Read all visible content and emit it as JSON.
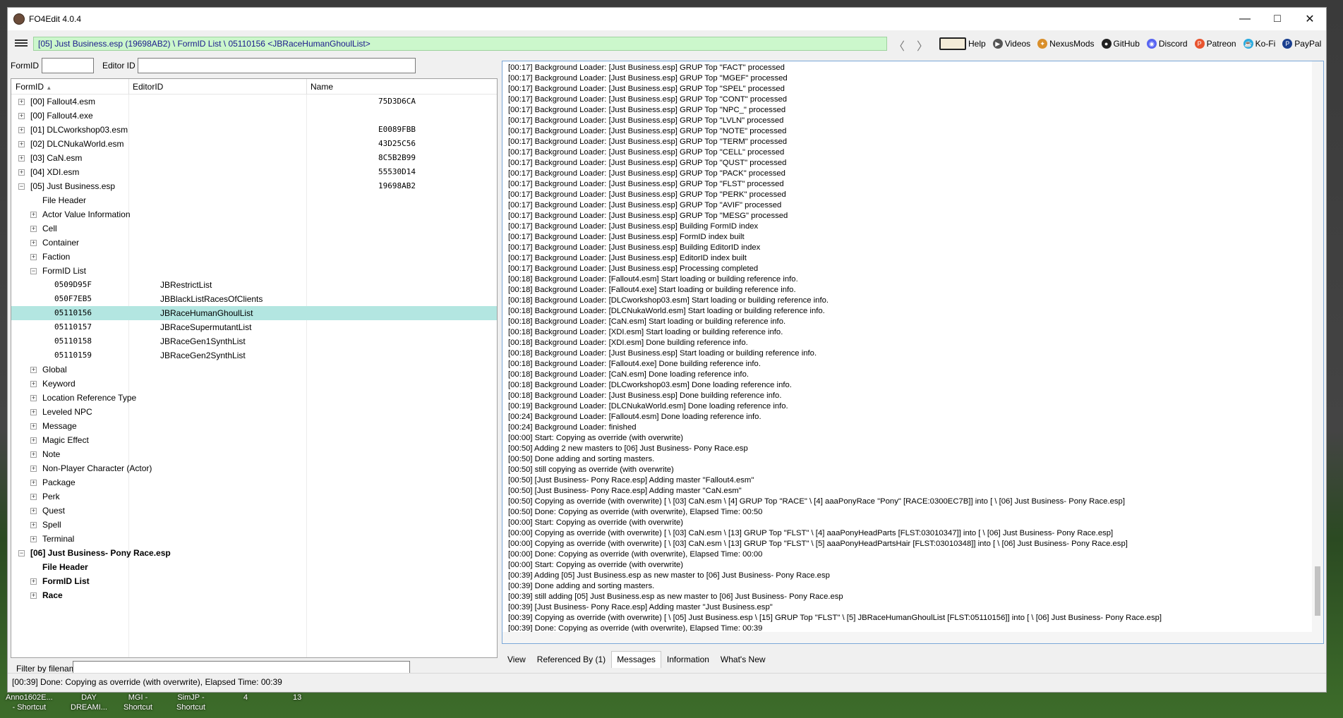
{
  "window": {
    "title": "FO4Edit 4.0.4"
  },
  "toolbar": {
    "path": "[05] Just Business.esp (19698AB2) \\ FormID List \\ 05110156 <JBRaceHumanGhoulList>",
    "back": "〈",
    "forward": "〉",
    "links": [
      "Help",
      "Videos",
      "NexusMods",
      "GitHub",
      "Discord",
      "Patreon",
      "Ko-Fi",
      "PayPal"
    ]
  },
  "search": {
    "formid_label": "FormID",
    "editorid_label": "Editor ID",
    "formid_value": "",
    "editorid_value": ""
  },
  "tree": {
    "headers": {
      "formid": "FormID",
      "editorid": "EditorID",
      "name": "Name"
    },
    "rows": [
      {
        "indent": 0,
        "pm": "+",
        "text": "[00] Fallout4.esm",
        "name": "75D3D6CA"
      },
      {
        "indent": 0,
        "pm": "+",
        "text": "[00] Fallout4.exe",
        "name": ""
      },
      {
        "indent": 0,
        "pm": "+",
        "text": "[01] DLCworkshop03.esm",
        "name": "E0089FBB"
      },
      {
        "indent": 0,
        "pm": "+",
        "text": "[02] DLCNukaWorld.esm",
        "name": "43D25C56"
      },
      {
        "indent": 0,
        "pm": "+",
        "text": "[03] CaN.esm",
        "name": "8C5B2B99"
      },
      {
        "indent": 0,
        "pm": "+",
        "text": "[04] XDI.esm",
        "name": "55530D14"
      },
      {
        "indent": 0,
        "pm": "-",
        "text": "[05] Just Business.esp",
        "name": "19698AB2"
      },
      {
        "indent": 1,
        "pm": "",
        "text": "File Header"
      },
      {
        "indent": 1,
        "pm": "+",
        "text": "Actor Value Information"
      },
      {
        "indent": 1,
        "pm": "+",
        "text": "Cell"
      },
      {
        "indent": 1,
        "pm": "+",
        "text": "Container"
      },
      {
        "indent": 1,
        "pm": "+",
        "text": "Faction"
      },
      {
        "indent": 1,
        "pm": "-",
        "text": "FormID List"
      },
      {
        "indent": 2,
        "pm": "",
        "text": "0509D95F",
        "edid": "JBRestrictList",
        "mono": true
      },
      {
        "indent": 2,
        "pm": "",
        "text": "050F7EB5",
        "edid": "JBBlackListRacesOfClients",
        "mono": true
      },
      {
        "indent": 2,
        "pm": "",
        "text": "05110156",
        "edid": "JBRaceHumanGhoulList",
        "mono": true,
        "selected": true
      },
      {
        "indent": 2,
        "pm": "",
        "text": "05110157",
        "edid": "JBRaceSupermutantList",
        "mono": true
      },
      {
        "indent": 2,
        "pm": "",
        "text": "05110158",
        "edid": "JBRaceGen1SynthList",
        "mono": true
      },
      {
        "indent": 2,
        "pm": "",
        "text": "05110159",
        "edid": "JBRaceGen2SynthList",
        "mono": true
      },
      {
        "indent": 1,
        "pm": "+",
        "text": "Global"
      },
      {
        "indent": 1,
        "pm": "+",
        "text": "Keyword"
      },
      {
        "indent": 1,
        "pm": "+",
        "text": "Location Reference Type"
      },
      {
        "indent": 1,
        "pm": "+",
        "text": "Leveled NPC"
      },
      {
        "indent": 1,
        "pm": "+",
        "text": "Message"
      },
      {
        "indent": 1,
        "pm": "+",
        "text": "Magic Effect"
      },
      {
        "indent": 1,
        "pm": "+",
        "text": "Note"
      },
      {
        "indent": 1,
        "pm": "+",
        "text": "Non-Player Character (Actor)"
      },
      {
        "indent": 1,
        "pm": "+",
        "text": "Package"
      },
      {
        "indent": 1,
        "pm": "+",
        "text": "Perk"
      },
      {
        "indent": 1,
        "pm": "+",
        "text": "Quest"
      },
      {
        "indent": 1,
        "pm": "+",
        "text": "Spell"
      },
      {
        "indent": 1,
        "pm": "+",
        "text": "Terminal"
      },
      {
        "indent": 0,
        "pm": "-",
        "text": "[06] Just Business- Pony Race.esp",
        "bold": true
      },
      {
        "indent": 1,
        "pm": "",
        "text": "File Header",
        "bold": true
      },
      {
        "indent": 1,
        "pm": "+",
        "text": "FormID List",
        "bold": true
      },
      {
        "indent": 1,
        "pm": "+",
        "text": "Race",
        "bold": true
      }
    ]
  },
  "filter": {
    "label": "Filter by filename:",
    "value": ""
  },
  "messages": [
    "[00:17] Background Loader: [Just Business.esp] GRUP Top \"FACT\" processed",
    "[00:17] Background Loader: [Just Business.esp] GRUP Top \"MGEF\" processed",
    "[00:17] Background Loader: [Just Business.esp] GRUP Top \"SPEL\" processed",
    "[00:17] Background Loader: [Just Business.esp] GRUP Top \"CONT\" processed",
    "[00:17] Background Loader: [Just Business.esp] GRUP Top \"NPC_\" processed",
    "[00:17] Background Loader: [Just Business.esp] GRUP Top \"LVLN\" processed",
    "[00:17] Background Loader: [Just Business.esp] GRUP Top \"NOTE\" processed",
    "[00:17] Background Loader: [Just Business.esp] GRUP Top \"TERM\" processed",
    "[00:17] Background Loader: [Just Business.esp] GRUP Top \"CELL\" processed",
    "[00:17] Background Loader: [Just Business.esp] GRUP Top \"QUST\" processed",
    "[00:17] Background Loader: [Just Business.esp] GRUP Top \"PACK\" processed",
    "[00:17] Background Loader: [Just Business.esp] GRUP Top \"FLST\" processed",
    "[00:17] Background Loader: [Just Business.esp] GRUP Top \"PERK\" processed",
    "[00:17] Background Loader: [Just Business.esp] GRUP Top \"AVIF\" processed",
    "[00:17] Background Loader: [Just Business.esp] GRUP Top \"MESG\" processed",
    "[00:17] Background Loader: [Just Business.esp] Building FormID index",
    "[00:17] Background Loader: [Just Business.esp] FormID index built",
    "[00:17] Background Loader: [Just Business.esp] Building EditorID index",
    "[00:17] Background Loader: [Just Business.esp] EditorID index built",
    "[00:17] Background Loader: [Just Business.esp] Processing completed",
    "[00:18] Background Loader: [Fallout4.esm] Start loading or building reference info.",
    "[00:18] Background Loader: [Fallout4.exe] Start loading or building reference info.",
    "[00:18] Background Loader: [DLCworkshop03.esm] Start loading or building reference info.",
    "[00:18] Background Loader: [DLCNukaWorld.esm] Start loading or building reference info.",
    "[00:18] Background Loader: [CaN.esm] Start loading or building reference info.",
    "[00:18] Background Loader: [XDI.esm] Start loading or building reference info.",
    "[00:18] Background Loader: [XDI.esm] Done building reference info.",
    "[00:18] Background Loader: [Just Business.esp] Start loading or building reference info.",
    "[00:18] Background Loader: [Fallout4.exe] Done building reference info.",
    "[00:18] Background Loader: [CaN.esm] Done loading reference info.",
    "[00:18] Background Loader: [DLCworkshop03.esm] Done loading reference info.",
    "[00:18] Background Loader: [Just Business.esp] Done building reference info.",
    "[00:19] Background Loader: [DLCNukaWorld.esm] Done loading reference info.",
    "[00:24] Background Loader: [Fallout4.esm] Done loading reference info.",
    "[00:24] Background Loader: finished",
    "[00:00] Start: Copying as override (with overwrite)",
    "[00:50] Adding 2 new masters to [06] Just Business- Pony Race.esp",
    "[00:50] Done adding and sorting masters.",
    "[00:50] still copying as override (with overwrite)",
    "[00:50] [Just Business- Pony Race.esp] Adding master \"Fallout4.esm\"",
    "[00:50] [Just Business- Pony Race.esp] Adding master \"CaN.esm\"",
    "[00:50] Copying as override (with overwrite) [ \\ [03] CaN.esm \\ [4] GRUP Top \"RACE\" \\ [4] aaaPonyRace \"Pony\" [RACE:0300EC7B]] into [ \\ [06] Just Business- Pony Race.esp]",
    "[00:50] Done: Copying as override (with overwrite), Elapsed Time: 00:50",
    "[00:00] Start: Copying as override (with overwrite)",
    "[00:00] Copying as override (with overwrite) [ \\ [03] CaN.esm \\ [13] GRUP Top \"FLST\" \\ [4] aaaPonyHeadParts [FLST:03010347]] into [ \\ [06] Just Business- Pony Race.esp]",
    "[00:00] Copying as override (with overwrite) [ \\ [03] CaN.esm \\ [13] GRUP Top \"FLST\" \\ [5] aaaPonyHeadPartsHair [FLST:03010348]] into [ \\ [06] Just Business- Pony Race.esp]",
    "[00:00] Done: Copying as override (with overwrite), Elapsed Time: 00:00",
    "[00:00] Start: Copying as override (with overwrite)",
    "[00:39] Adding [05] Just Business.esp as new master to [06] Just Business- Pony Race.esp",
    "[00:39] Done adding and sorting masters.",
    "[00:39] still adding [05] Just Business.esp as new master to [06] Just Business- Pony Race.esp",
    "[00:39] [Just Business- Pony Race.esp] Adding master \"Just Business.esp\"",
    "[00:39] Copying as override (with overwrite) [ \\ [05] Just Business.esp \\ [15] GRUP Top \"FLST\" \\ [5] JBRaceHumanGhoulList [FLST:05110156]] into [ \\ [06] Just Business- Pony Race.esp]",
    "[00:39] Done: Copying as override (with overwrite), Elapsed Time: 00:39"
  ],
  "tabs": [
    {
      "label": "View",
      "active": false
    },
    {
      "label": "Referenced By (1)",
      "active": false
    },
    {
      "label": "Messages",
      "active": true
    },
    {
      "label": "Information",
      "active": false
    },
    {
      "label": "What's New",
      "active": false
    }
  ],
  "status": "[00:39] Done: Copying as override (with overwrite), Elapsed Time: 00:39",
  "taskbar": [
    {
      "label": "Anno1602E...\n- Shortcut"
    },
    {
      "label": "DAY\nDREAMI..."
    },
    {
      "label": "MGI -\nShortcut"
    },
    {
      "label": "SimJP -\nShortcut"
    },
    {
      "label": "4"
    },
    {
      "label": "13"
    }
  ]
}
